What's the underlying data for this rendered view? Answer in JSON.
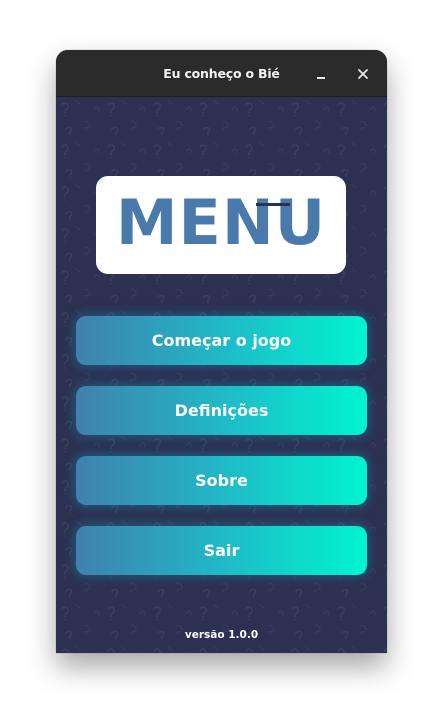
{
  "window": {
    "title": "Eu conheço o Bié",
    "minimize_icon": "minimize-icon",
    "close_icon": "close-icon"
  },
  "logo": {
    "text": "MENU",
    "color": "#4a7aab"
  },
  "menu": {
    "buttons": [
      {
        "label": "Começar o jogo"
      },
      {
        "label": "Definições"
      },
      {
        "label": "Sobre"
      },
      {
        "label": "Sair"
      }
    ]
  },
  "footer": {
    "version": "versão 1.0.0"
  },
  "colors": {
    "background": "#2c3051",
    "titlebar": "#2b2b2b",
    "button_gradient_start": "#4180ad",
    "button_gradient_end": "#00f5cf"
  }
}
